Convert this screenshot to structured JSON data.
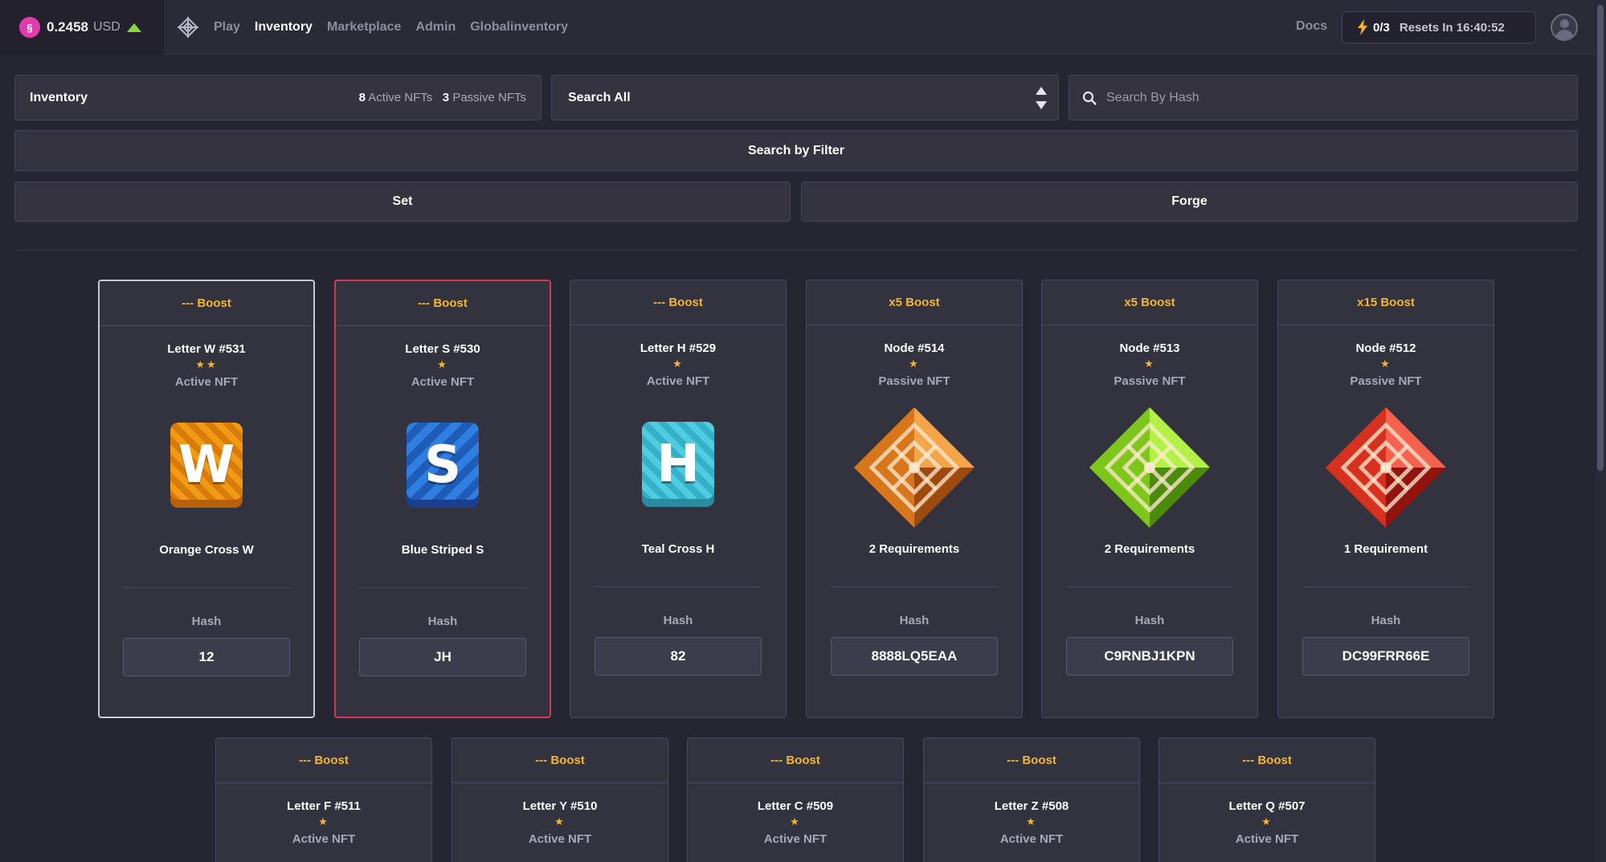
{
  "header": {
    "price": "0.2458",
    "currency": "USD",
    "nav": [
      "Play",
      "Inventory",
      "Marketplace",
      "Admin",
      "Globalinventory"
    ],
    "docs": "Docs",
    "energy_count": "0/3",
    "energy_reset": "Resets In 16:40:52"
  },
  "inventory": {
    "title": "Inventory",
    "active_count": "8",
    "active_label": "Active NFTs",
    "passive_count": "3",
    "passive_label": "Passive NFTs"
  },
  "search": {
    "select_value": "Search All",
    "hash_placeholder": "Search By Hash"
  },
  "buttons": {
    "filter": "Search by Filter",
    "set": "Set",
    "forge": "Forge"
  },
  "labels": {
    "hash": "Hash"
  },
  "colors": {
    "accent_gold": "#f5b62d",
    "selected_red": "#d23a55",
    "price_up_green": "#8ad43c"
  },
  "cards": [
    {
      "boost": "--- Boost",
      "name": "Letter W #531",
      "stars": "★★",
      "type": "Active NFT",
      "desc": "Orange Cross W",
      "hash": "12",
      "art": "letter",
      "letter": "W",
      "color": "orange",
      "border": "white"
    },
    {
      "boost": "--- Boost",
      "name": "Letter S #530",
      "stars": "★",
      "type": "Active NFT",
      "desc": "Blue Striped S",
      "hash": "JH",
      "art": "letter",
      "letter": "S",
      "color": "blue",
      "border": "red"
    },
    {
      "boost": "--- Boost",
      "name": "Letter H #529",
      "stars": "★",
      "type": "Active NFT",
      "desc": "Teal Cross H",
      "hash": "82",
      "art": "letter",
      "letter": "H",
      "color": "teal",
      "border": "none"
    },
    {
      "boost": "x5 Boost",
      "name": "Node #514",
      "stars": "★",
      "type": "Passive NFT",
      "desc": "2 Requirements",
      "hash": "8888LQ5EAA",
      "art": "node",
      "color": "orange",
      "border": "none"
    },
    {
      "boost": "x5 Boost",
      "name": "Node #513",
      "stars": "★",
      "type": "Passive NFT",
      "desc": "2 Requirements",
      "hash": "C9RNBJ1KPN",
      "art": "node",
      "color": "green",
      "border": "none"
    },
    {
      "boost": "x15 Boost",
      "name": "Node #512",
      "stars": "★",
      "type": "Passive NFT",
      "desc": "1 Requirement",
      "hash": "DC99FRR66E",
      "art": "node",
      "color": "red",
      "border": "none"
    },
    {
      "boost": "--- Boost",
      "name": "Letter F #511",
      "stars": "★",
      "type": "Active NFT",
      "border": "none"
    },
    {
      "boost": "--- Boost",
      "name": "Letter Y #510",
      "stars": "★",
      "type": "Active NFT",
      "border": "none"
    },
    {
      "boost": "--- Boost",
      "name": "Letter C #509",
      "stars": "★",
      "type": "Active NFT",
      "border": "none"
    },
    {
      "boost": "--- Boost",
      "name": "Letter Z #508",
      "stars": "★",
      "type": "Active NFT",
      "border": "none"
    },
    {
      "boost": "--- Boost",
      "name": "Letter Q #507",
      "stars": "★",
      "type": "Active NFT",
      "border": "none"
    }
  ]
}
